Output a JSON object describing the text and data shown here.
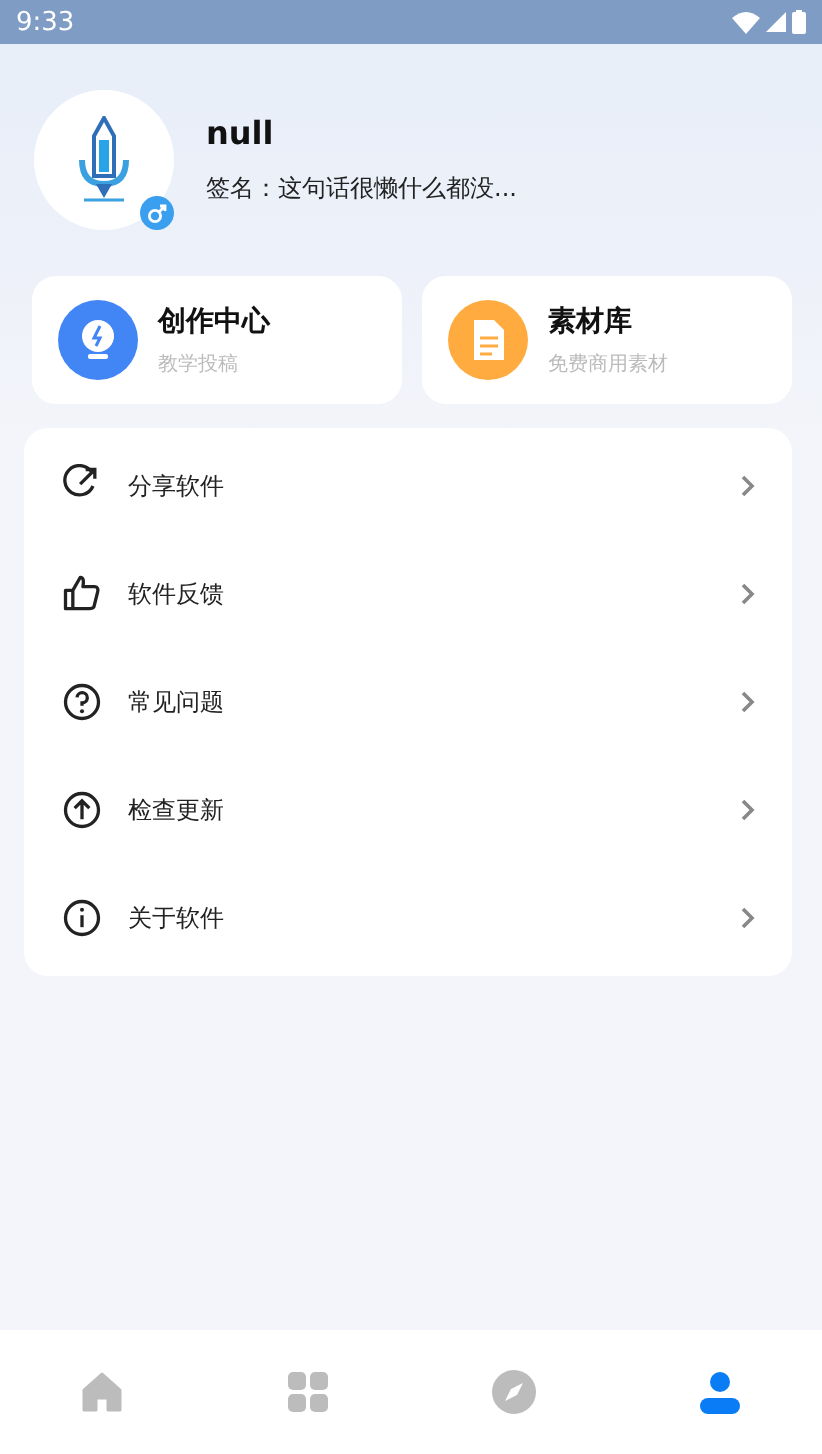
{
  "status_bar": {
    "time": "9:33"
  },
  "profile": {
    "name": "null",
    "signature": "签名：这句话很懒什么都没..."
  },
  "quick_cards": [
    {
      "kind": "bulb",
      "color": "#4285f4",
      "title": "创作中心",
      "subtitle": "教学投稿"
    },
    {
      "kind": "document",
      "color": "#ffab40",
      "title": "素材库",
      "subtitle": "免费商用素材"
    }
  ],
  "menu": [
    {
      "kind": "share",
      "label": "分享软件"
    },
    {
      "kind": "thumb",
      "label": "软件反馈"
    },
    {
      "kind": "question",
      "label": "常见问题"
    },
    {
      "kind": "update",
      "label": "检查更新"
    },
    {
      "kind": "info",
      "label": "关于软件"
    }
  ],
  "bottom_nav": [
    {
      "kind": "home",
      "selected": false
    },
    {
      "kind": "apps",
      "selected": false
    },
    {
      "kind": "compass",
      "selected": false
    },
    {
      "kind": "person",
      "selected": true
    }
  ]
}
